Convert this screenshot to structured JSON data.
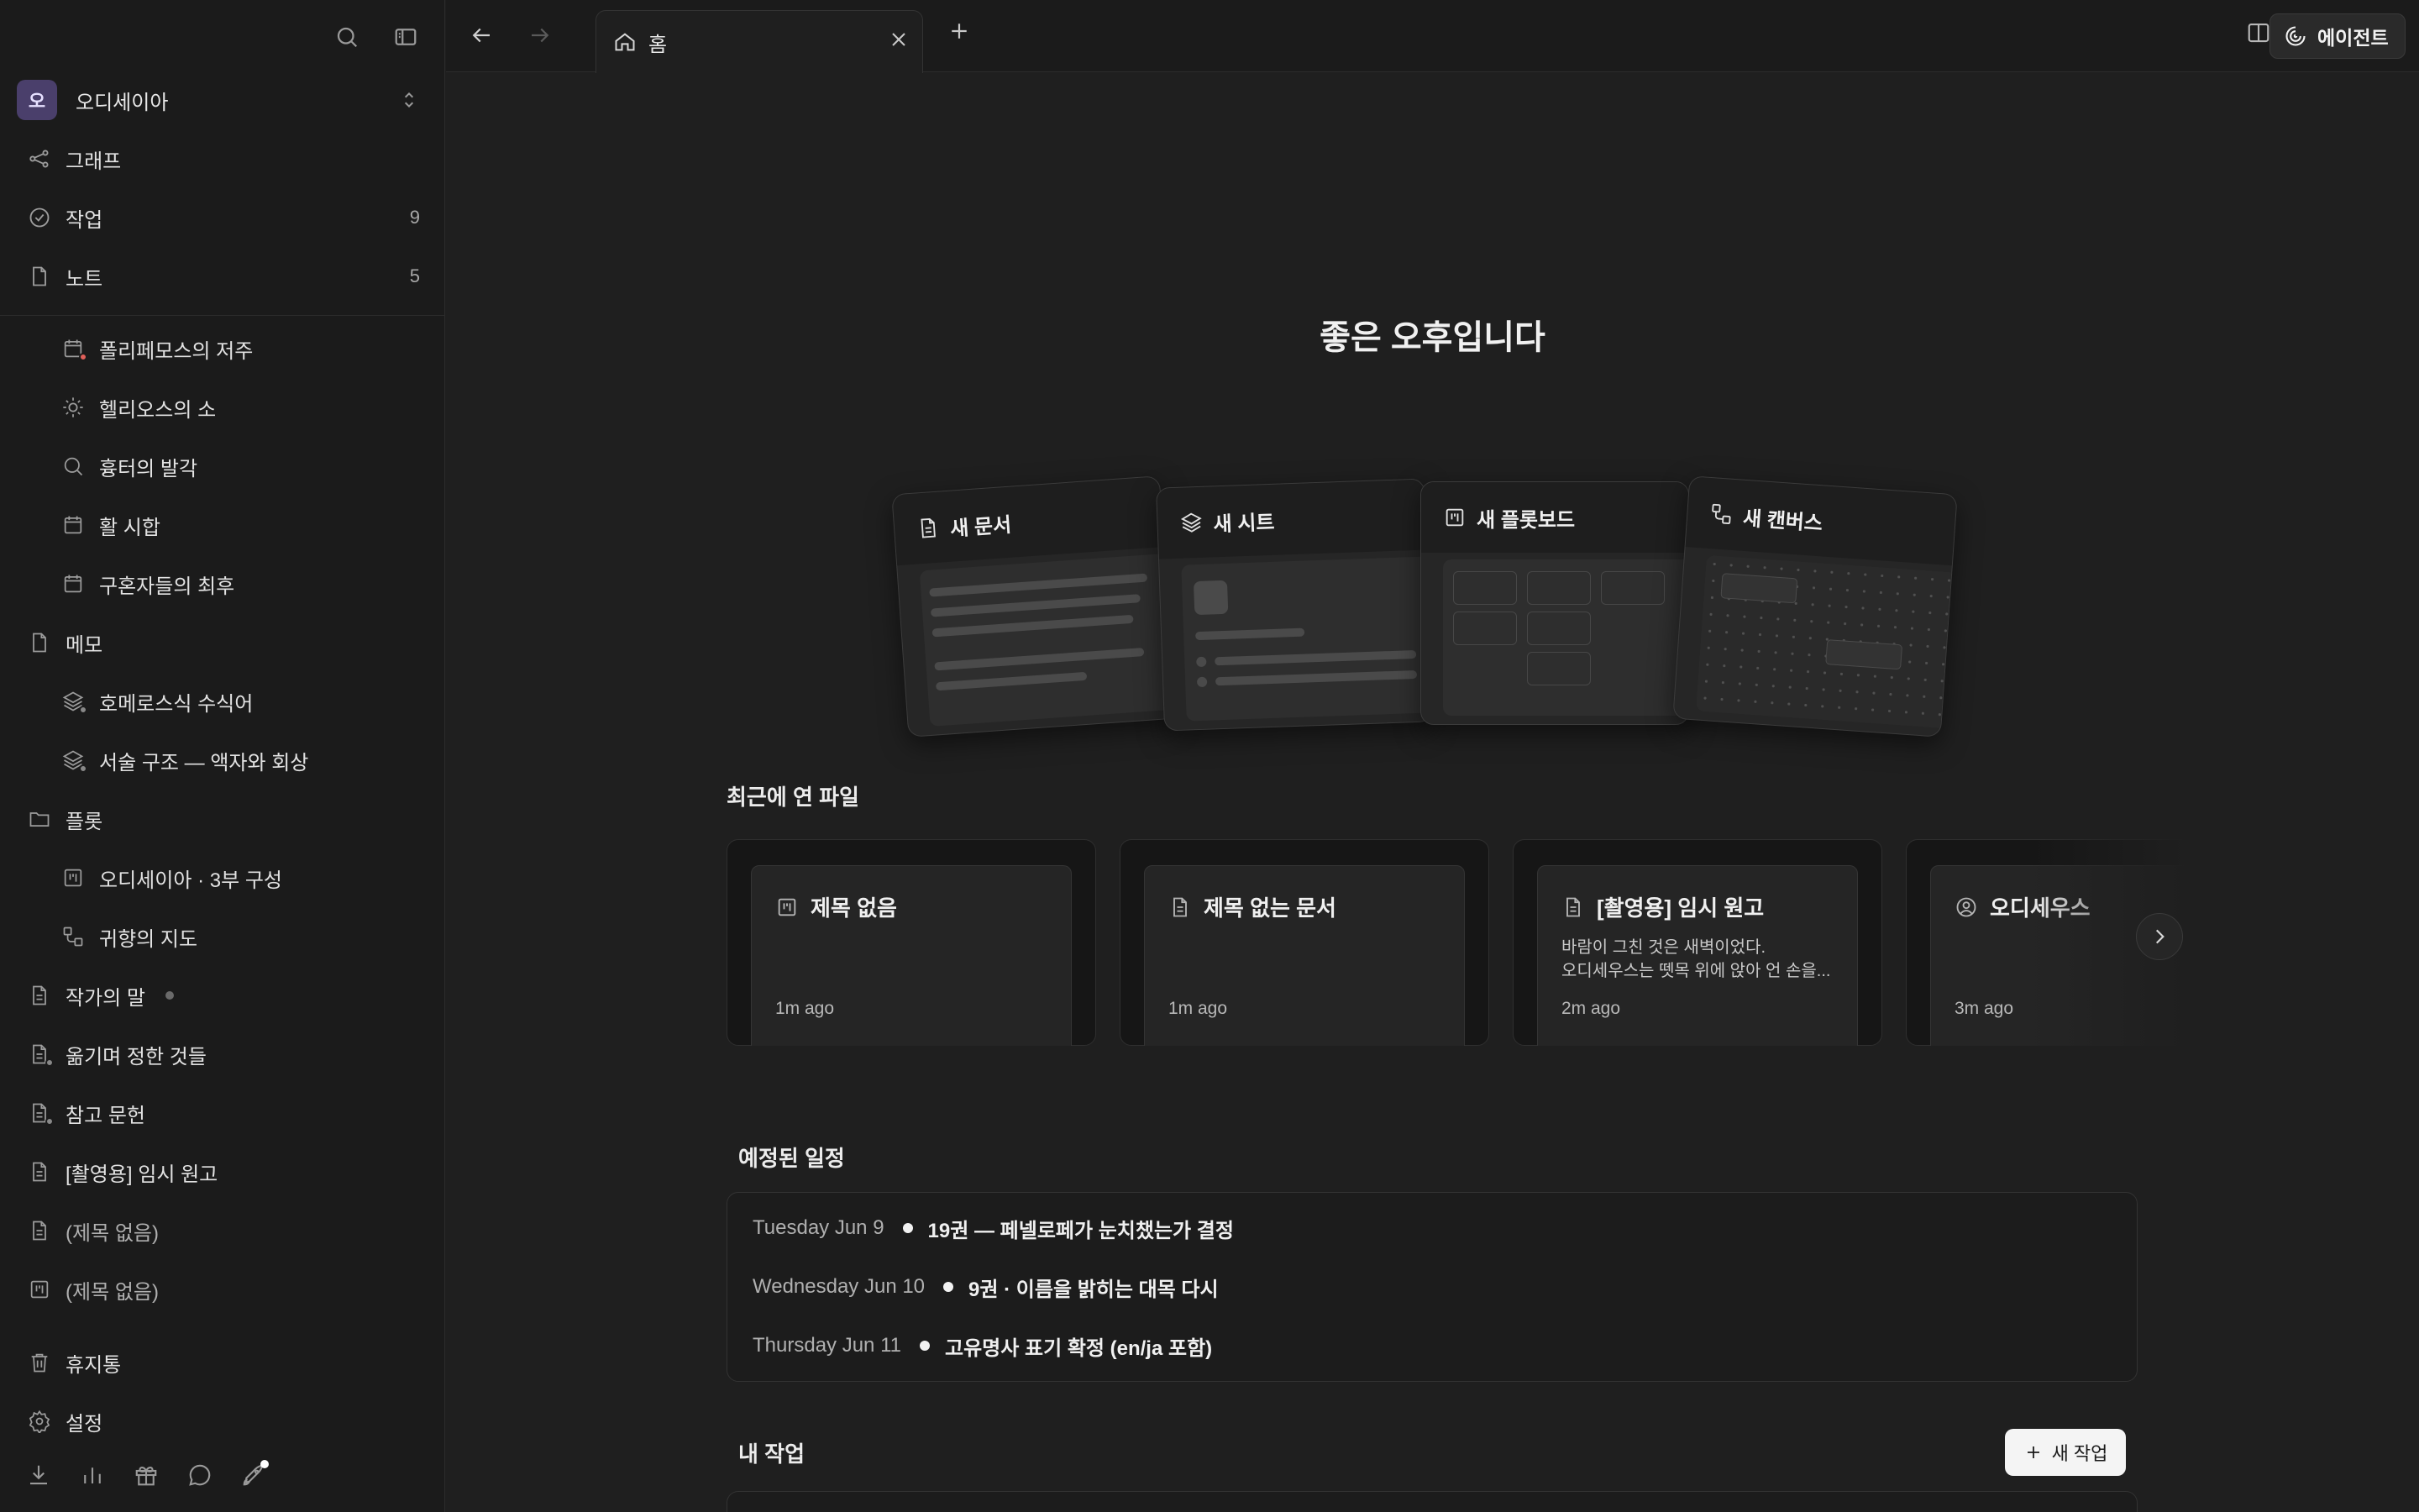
{
  "sidebar": {
    "workspace": {
      "avatar_letter": "오",
      "name": "오디세이아"
    },
    "primary": [
      {
        "label": "그래프",
        "icon": "graph-icon"
      },
      {
        "label": "작업",
        "icon": "check-circle-icon",
        "count": "9"
      },
      {
        "label": "노트",
        "icon": "file-icon",
        "count": "5"
      }
    ],
    "notes": [
      {
        "label": "폴리페모스의 저주",
        "icon": "calendar-icon"
      },
      {
        "label": "헬리오스의 소",
        "icon": "sun-icon"
      },
      {
        "label": "흉터의 발각",
        "icon": "search-icon"
      },
      {
        "label": "활 시합",
        "icon": "calendar-icon"
      },
      {
        "label": "구혼자들의 최후",
        "icon": "calendar-icon"
      }
    ],
    "memo": {
      "label": "메모",
      "icon": "file-icon"
    },
    "memo_items": [
      {
        "label": "호메로스식 수식어",
        "icon": "layers-icon"
      },
      {
        "label": "서술 구조 — 액자와 회상",
        "icon": "layers-icon"
      }
    ],
    "plot": {
      "label": "플롯",
      "icon": "folder-icon"
    },
    "plot_items": [
      {
        "label": "오디세이아 · 3부 구성",
        "icon": "kanban-icon"
      },
      {
        "label": "귀향의 지도",
        "icon": "canvas-icon"
      }
    ],
    "docs": [
      {
        "label": "작가의 말",
        "icon": "document-icon"
      },
      {
        "label": "옮기며 정한 것들",
        "icon": "document-icon"
      },
      {
        "label": "참고 문헌",
        "icon": "document-icon"
      },
      {
        "label": "[촬영용] 임시 원고",
        "icon": "document-icon"
      },
      {
        "label": "(제목 없음)",
        "icon": "document-icon"
      },
      {
        "label": "(제목 없음)",
        "icon": "kanban-icon"
      }
    ],
    "trash": "휴지통",
    "settings": "설정"
  },
  "topbar": {
    "tab_label": "홈",
    "agent_label": "에이전트"
  },
  "main": {
    "greeting": "좋은 오후입니다",
    "new_cards": [
      {
        "label": "새 문서",
        "icon": "document-icon"
      },
      {
        "label": "새 시트",
        "icon": "layers-icon"
      },
      {
        "label": "새 플롯보드",
        "icon": "kanban-icon"
      },
      {
        "label": "새 캔버스",
        "icon": "canvas-icon"
      }
    ],
    "recent_title": "최근에 연 파일",
    "recent": [
      {
        "title": "제목 없음",
        "icon": "kanban-icon",
        "preview1": "",
        "preview2": "",
        "time": "1m ago"
      },
      {
        "title": "제목 없는 문서",
        "icon": "document-icon",
        "preview1": "",
        "preview2": "",
        "time": "1m ago"
      },
      {
        "title": "[촬영용] 임시 원고",
        "icon": "document-icon",
        "preview1": "바람이 그친 것은 새벽이었다.",
        "preview2": "오디세우스는 뗏목 위에 앉아 언 손을...",
        "time": "2m ago"
      },
      {
        "title": "오디세우스",
        "icon": "person-icon",
        "preview1": "",
        "preview2": "",
        "time": "3m ago"
      }
    ],
    "schedule_title": "예정된 일정",
    "schedule": [
      {
        "date": "Tuesday Jun 9",
        "text": "19권 — 페넬로페가 눈치챘는가 결정"
      },
      {
        "date": "Wednesday Jun 10",
        "text": "9권 · 이름을 밝히는 대목 다시"
      },
      {
        "date": "Thursday Jun 11",
        "text": "고유명사 표기 확정 (en/ja 포함)"
      }
    ],
    "tasks_title": "내 작업",
    "new_task_label": "새 작업"
  }
}
